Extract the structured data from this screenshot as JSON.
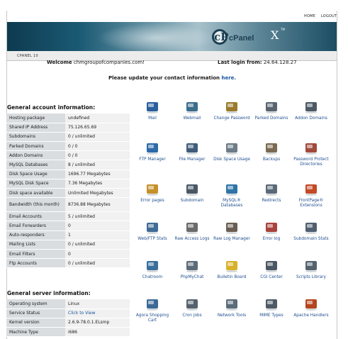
{
  "topnav": {
    "home": "HOME",
    "logout": "LOGOUT"
  },
  "banner": {
    "logo_mark": "cP",
    "logo_word": "cPanel",
    "version_mark": "X",
    "tm": "TM"
  },
  "crumb": "CPANEL 10",
  "welcome": {
    "label": "Welcome",
    "domain": "chmgroupofcompanies.com!"
  },
  "last_login": {
    "label": "Last login from:",
    "ip": "24.64.128.27"
  },
  "notice": {
    "text": "Please update your contact information",
    "link": "here."
  },
  "account": {
    "title": "General account information:",
    "rows": [
      {
        "k": "Hosting package",
        "v": "undefined"
      },
      {
        "k": "Shared IP Address",
        "v": "75.126.65.69"
      },
      {
        "k": "Subdomains",
        "v": "0 / unlimited"
      },
      {
        "k": "Parked Domains",
        "v": "0 / 0"
      },
      {
        "k": "Addon Domains",
        "v": "0 / 0"
      },
      {
        "k": "MySQL Databases",
        "v": "8 / unlimited"
      },
      {
        "k": "Disk Space Usage",
        "v": "1696.77 Megabytes"
      },
      {
        "k": "MySQL Disk Space",
        "v": "7.36 Megabytes"
      },
      {
        "k": "Disk space available",
        "v": "Unlimited Megabytes"
      },
      {
        "k": "Bandwidth (this month)",
        "v": "8736.88 Megabytes"
      },
      {
        "k": "Email Accounts",
        "v": "5 / unlimited"
      },
      {
        "k": "Email Forwarders",
        "v": "0"
      },
      {
        "k": "Auto-responders",
        "v": "1"
      },
      {
        "k": "Mailing Lists",
        "v": "0 / unlimited"
      },
      {
        "k": "Email Filters",
        "v": "0"
      },
      {
        "k": "Ftp Accounts",
        "v": "0 / unlimited"
      }
    ]
  },
  "server": {
    "title": "General server information:",
    "rows": [
      {
        "k": "Operating system",
        "v": "Linux"
      },
      {
        "k": "Service Status",
        "v": "Click to View"
      },
      {
        "k": "Kernel version",
        "v": "2.6.9-78.0.1.ELsmp"
      },
      {
        "k": "Machine Type",
        "v": "i686"
      }
    ]
  },
  "icons": [
    {
      "label": "Mail",
      "icon": "mail-icon",
      "color": "#2a5f9e"
    },
    {
      "label": "Webmail",
      "icon": "webmail-icon",
      "color": "#3b6d8c"
    },
    {
      "label": "Change Password",
      "icon": "key-icon",
      "color": "#9a7b2c"
    },
    {
      "label": "Parked Domains",
      "icon": "parked-domains-icon",
      "color": "#5a6470"
    },
    {
      "label": "Addon Domains",
      "icon": "addon-domains-icon",
      "color": "#4c5a66"
    },
    {
      "label": "FTP Manager",
      "icon": "ftp-manager-icon",
      "color": "#2d6aa8"
    },
    {
      "label": "File Manager",
      "icon": "file-manager-icon",
      "color": "#3f5d7a"
    },
    {
      "label": "Disk Space Usage",
      "icon": "disk-space-icon",
      "color": "#6c7c88"
    },
    {
      "label": "Backups",
      "icon": "backups-icon",
      "color": "#7a6a52"
    },
    {
      "label": "Password Protect Directories",
      "icon": "password-protect-icon",
      "color": "#a04a3c"
    },
    {
      "label": "Error pages",
      "icon": "error-pages-icon",
      "color": "#c6902a"
    },
    {
      "label": "Subdomain",
      "icon": "subdomain-icon",
      "color": "#4a5866"
    },
    {
      "label": "MySQL® Databases",
      "icon": "mysql-icon",
      "color": "#2f74a6"
    },
    {
      "label": "Redirects",
      "icon": "redirects-icon",
      "color": "#5b6a78"
    },
    {
      "label": "FrontPage® Extensions",
      "icon": "frontpage-icon",
      "color": "#c44a28"
    },
    {
      "label": "Web/FTP Stats",
      "icon": "stats-icon",
      "color": "#3f6b95"
    },
    {
      "label": "Raw Access Logs",
      "icon": "raw-logs-icon",
      "color": "#6a6a6a"
    },
    {
      "label": "Raw Log Manager",
      "icon": "log-manager-icon",
      "color": "#6a5e52"
    },
    {
      "label": "Error log",
      "icon": "error-log-icon",
      "color": "#a8423c"
    },
    {
      "label": "Subdomain Stats",
      "icon": "subdomain-stats-icon",
      "color": "#4f5f70"
    },
    {
      "label": "Chatroom",
      "icon": "chatroom-icon",
      "color": "#3a6e9c"
    },
    {
      "label": "PhpMyChat",
      "icon": "phpmychat-icon",
      "color": "#5c6b78"
    },
    {
      "label": "Bulletin Board",
      "icon": "bulletin-board-icon",
      "color": "#d8b12a"
    },
    {
      "label": "CGI Center",
      "icon": "cgi-center-icon",
      "color": "#4a5663"
    },
    {
      "label": "Scripts Library",
      "icon": "scripts-library-icon",
      "color": "#54626e"
    },
    {
      "label": "Agora Shopping Cart",
      "icon": "shopping-cart-icon",
      "color": "#3d6a95"
    },
    {
      "label": "Cron jobs",
      "icon": "cron-jobs-icon",
      "color": "#55626e"
    },
    {
      "label": "Network Tools",
      "icon": "network-tools-icon",
      "color": "#5a6b7a"
    },
    {
      "label": "MIME Types",
      "icon": "mime-types-icon",
      "color": "#4e5a66"
    },
    {
      "label": "Apache Handlers",
      "icon": "apache-handlers-icon",
      "color": "#b4451f"
    }
  ]
}
